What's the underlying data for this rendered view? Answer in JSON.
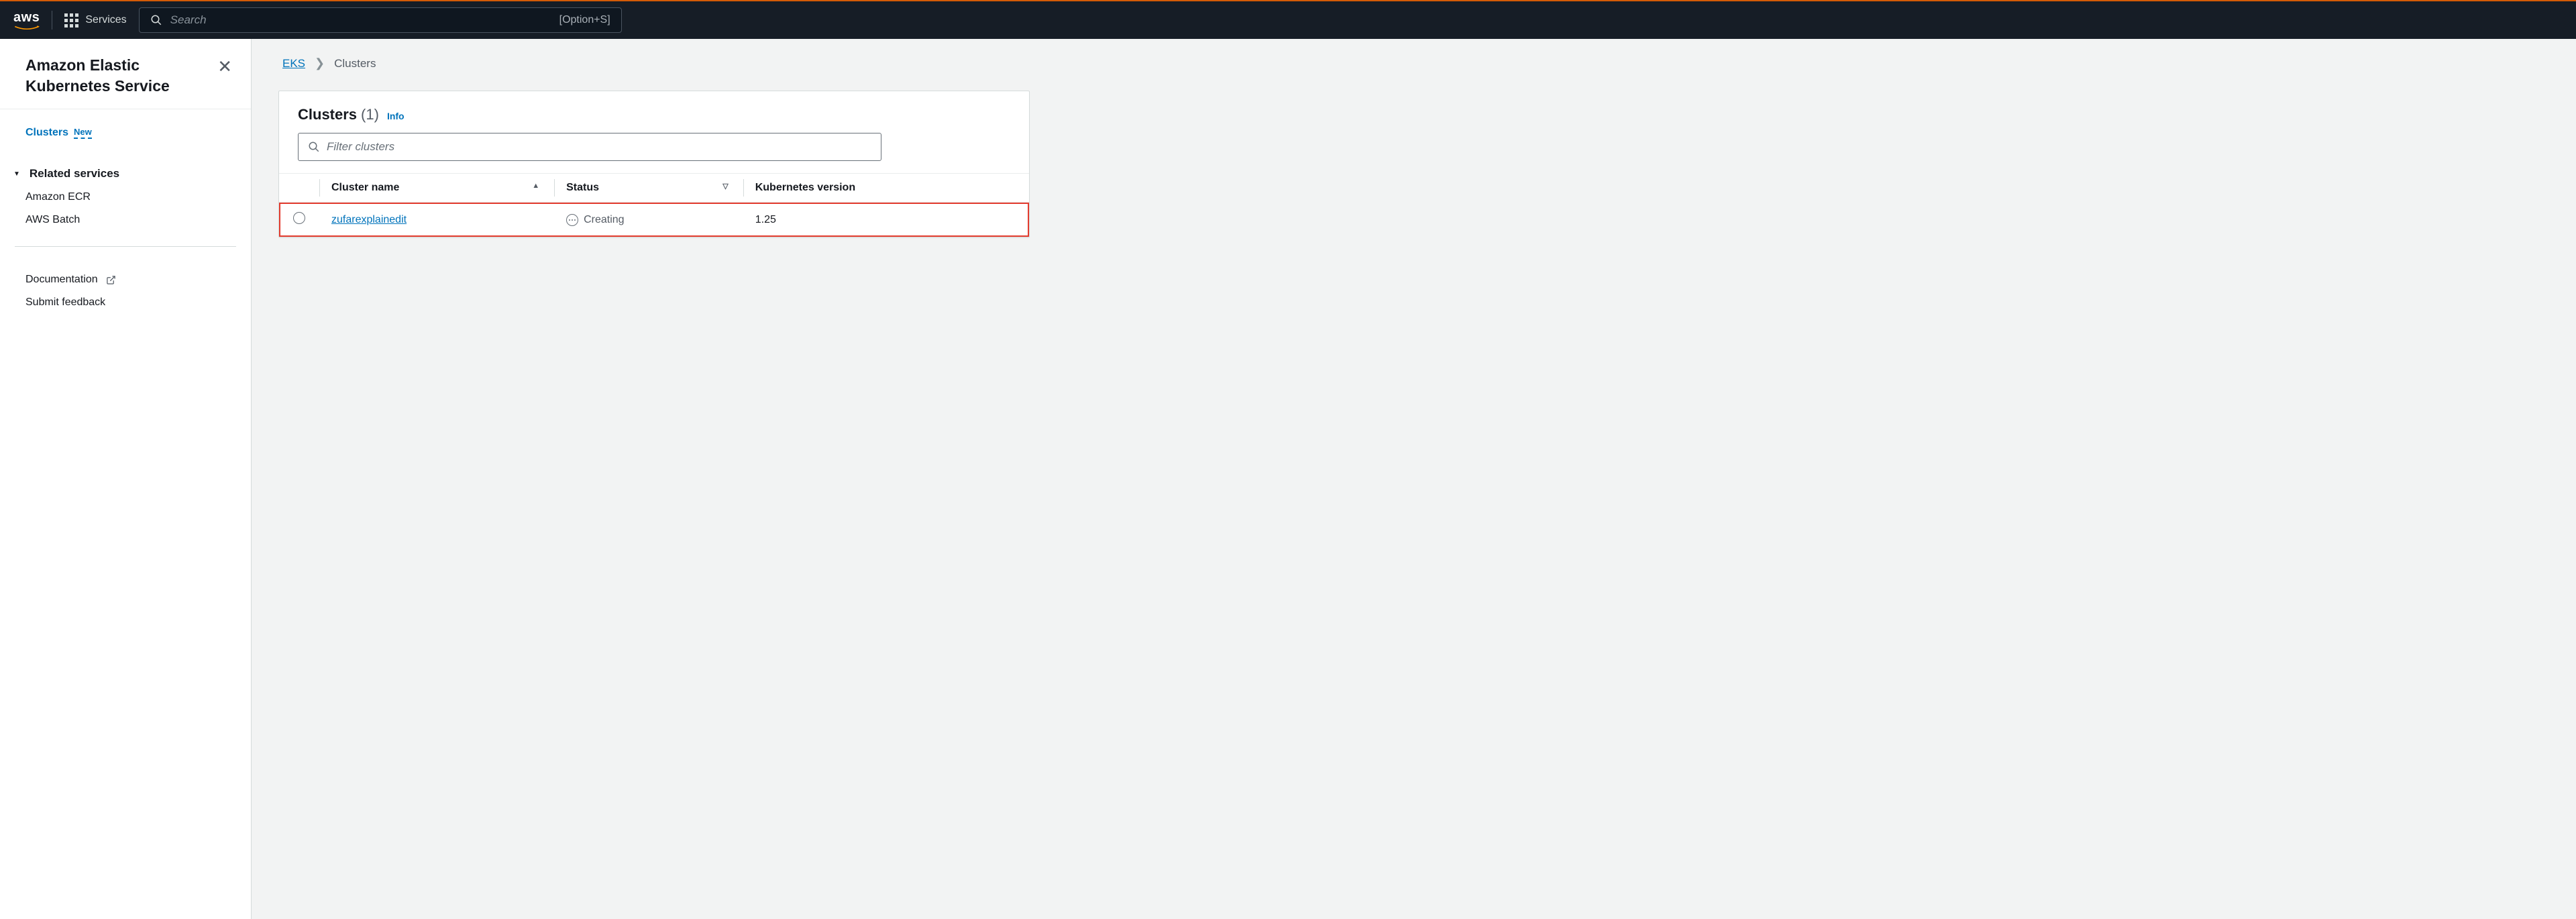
{
  "topnav": {
    "services_label": "Services",
    "search_placeholder": "Search",
    "search_shortcut": "[Option+S]"
  },
  "sidebar": {
    "title": "Amazon Elastic Kubernetes Service",
    "clusters_label": "Clusters",
    "clusters_badge": "New",
    "related_header": "Related services",
    "related_items": [
      "Amazon ECR",
      "AWS Batch"
    ],
    "footer": {
      "documentation": "Documentation",
      "feedback": "Submit feedback"
    }
  },
  "breadcrumb": {
    "root": "EKS",
    "current": "Clusters"
  },
  "panel": {
    "title": "Clusters",
    "count": "(1)",
    "info": "Info",
    "filter_placeholder": "Filter clusters",
    "columns": {
      "name": "Cluster name",
      "status": "Status",
      "version": "Kubernetes version"
    },
    "rows": [
      {
        "name": "zufarexplainedit",
        "status": "Creating",
        "version": "1.25"
      }
    ]
  }
}
